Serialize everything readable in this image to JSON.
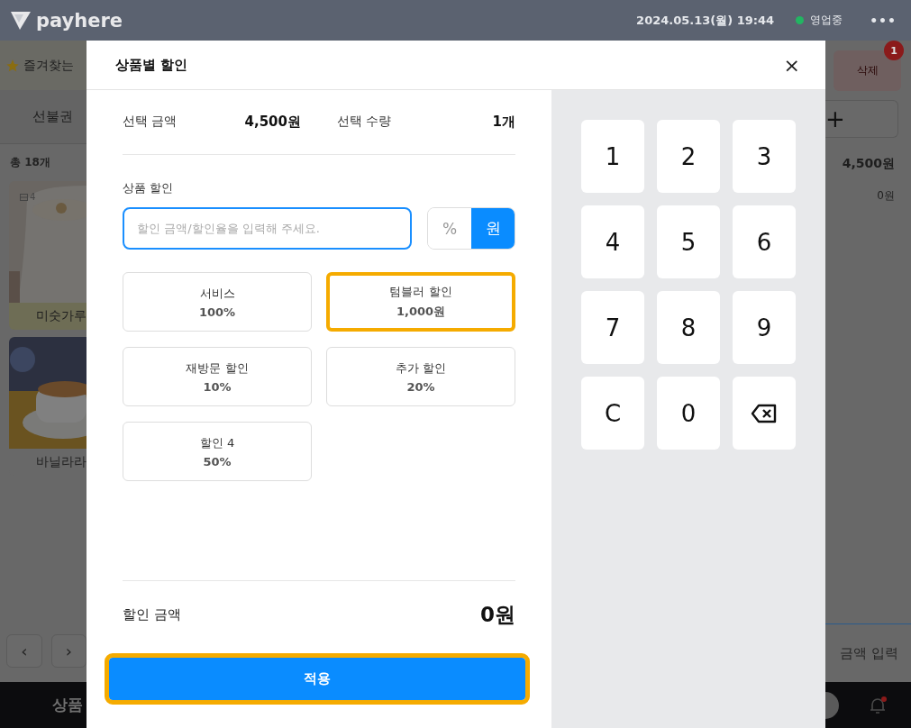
{
  "top_bar": {
    "logo": "payhere",
    "datetime": "2024.05.13(월) 19:44",
    "status": {
      "label": "영업중",
      "color": "#22b562"
    },
    "more": "•••"
  },
  "background": {
    "favorites_label": "즐겨찾는",
    "tab": "선불권",
    "count": "총 18개",
    "products": [
      {
        "badge": "4",
        "name": "미숫가루",
        "kind": "picture",
        "highlighted": true
      },
      {
        "name": "바닐라라",
        "kind": "picture",
        "highlighted": false
      }
    ],
    "pager": {
      "prev": "‹",
      "next": "›"
    },
    "bottom_label": "상품",
    "delete_button": "삭제",
    "delete_badge": "1",
    "add_button": "+",
    "total": "4,500원",
    "discount": "0원",
    "amount_input": "금액 입력"
  },
  "modal": {
    "title": "상품별 할인",
    "close": "×",
    "summary": [
      {
        "label": "선택 금액",
        "value": "4,500원"
      },
      {
        "label": "선택 수량",
        "value": "1개"
      }
    ],
    "discount_label": "상품 할인",
    "input": {
      "placeholder": "할인 금액/할인율을 입력해 주세요."
    },
    "units": [
      {
        "label": "%",
        "selected": false
      },
      {
        "label": "원",
        "selected": true
      }
    ],
    "presets": [
      {
        "name": "서비스",
        "value": "100%",
        "selected": false
      },
      {
        "name": "텀블러 할인",
        "value": "1,000원",
        "selected": true
      },
      {
        "name": "재방문 할인",
        "value": "10%",
        "selected": false
      },
      {
        "name": "추가 할인",
        "value": "20%",
        "selected": false
      },
      {
        "name": "할인 4",
        "value": "50%",
        "selected": false
      }
    ],
    "total": {
      "label": "할인 금액",
      "value": "0원"
    },
    "apply": {
      "label": "적용",
      "highlighted": true
    },
    "keypad": [
      {
        "kind": "key",
        "label": "1"
      },
      {
        "kind": "key",
        "label": "2"
      },
      {
        "kind": "key",
        "label": "3"
      },
      {
        "kind": "key",
        "label": "4"
      },
      {
        "kind": "key",
        "label": "5"
      },
      {
        "kind": "key",
        "label": "6"
      },
      {
        "kind": "key",
        "label": "7"
      },
      {
        "kind": "key",
        "label": "8"
      },
      {
        "kind": "key",
        "label": "9"
      },
      {
        "kind": "key",
        "label": "C"
      },
      {
        "kind": "key",
        "label": "0"
      },
      {
        "kind": "backspace"
      }
    ]
  }
}
